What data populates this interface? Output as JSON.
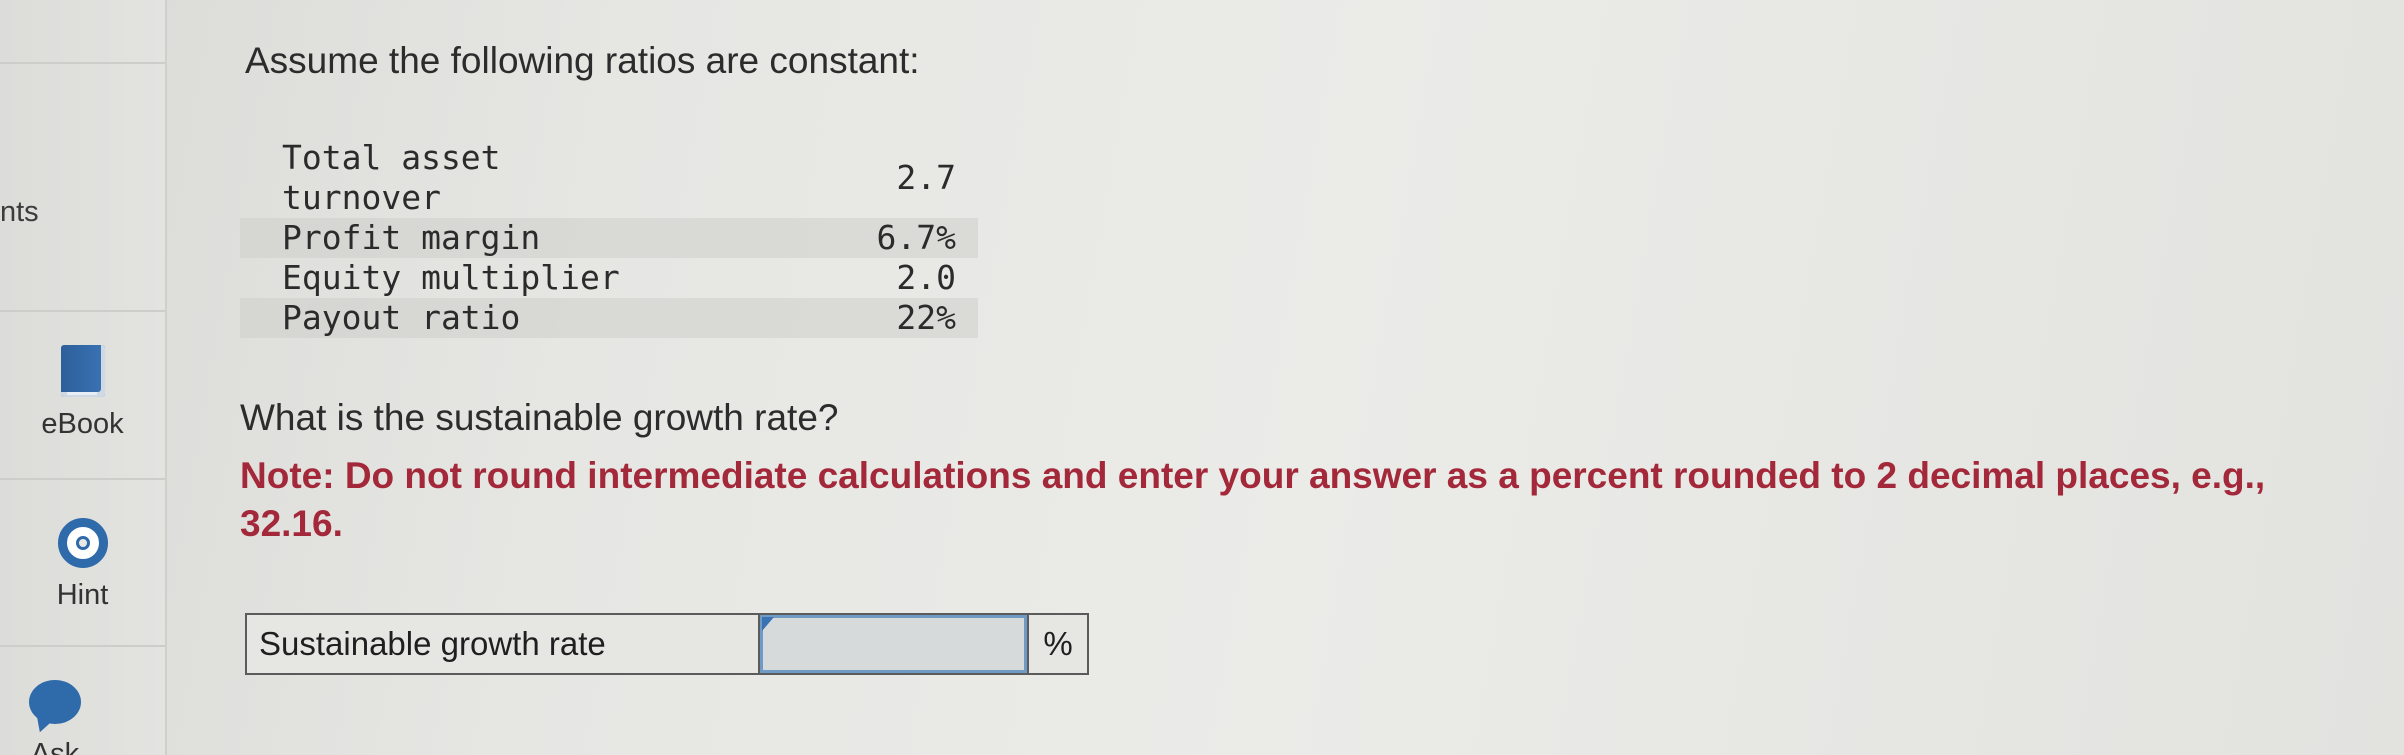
{
  "sidebar": {
    "partial_label": "nts",
    "items": [
      {
        "label": "eBook",
        "icon": "book-icon"
      },
      {
        "label": "Hint",
        "icon": "lifebuoy-icon"
      },
      {
        "label": "Ask",
        "icon": "chat-bubble-icon"
      }
    ]
  },
  "question": {
    "intro": "Assume the following ratios are constant:",
    "ratios": [
      {
        "name_line1": "Total asset",
        "name_line2": "turnover",
        "value": "2.7"
      },
      {
        "name": "Profit margin",
        "value": "6.7%"
      },
      {
        "name": "Equity multiplier",
        "value": "2.0"
      },
      {
        "name": "Payout ratio",
        "value": "22%"
      }
    ],
    "prompt": "What is the sustainable growth rate?",
    "note": "Note: Do not round intermediate calculations and enter your answer as a percent rounded to 2 decimal places, e.g., 32.16."
  },
  "answer": {
    "label": "Sustainable growth rate",
    "value": "",
    "unit": "%"
  },
  "colors": {
    "note_red": "#a3283a",
    "icon_blue": "#2f6aab",
    "input_border": "#6e9ac4"
  }
}
